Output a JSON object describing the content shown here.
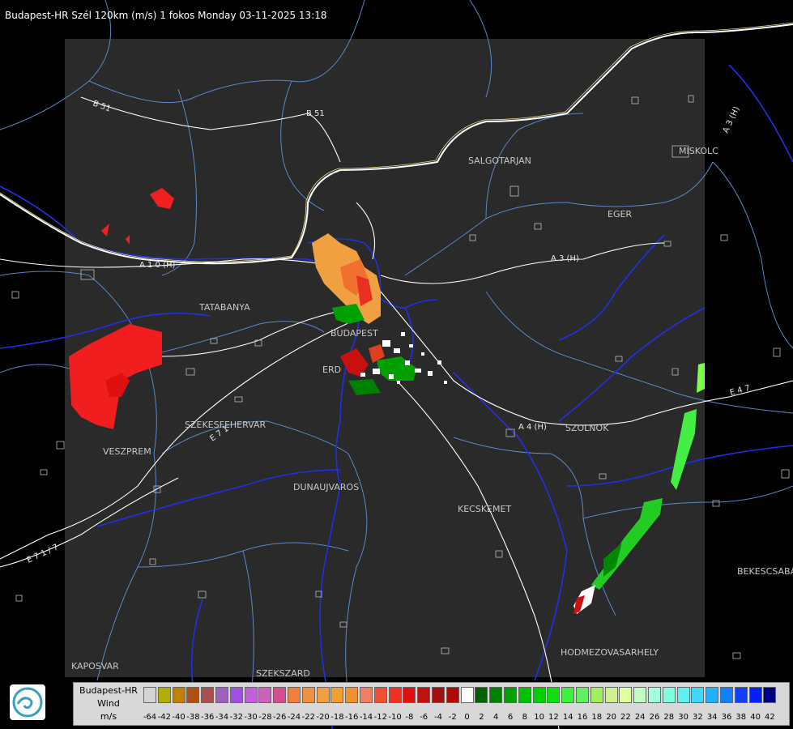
{
  "header": {
    "title": "Budapest-HR Szél 120km (m/s) 1 fokos Monday 03-11-2025 13:18"
  },
  "places": [
    "SALGOTARJAN",
    "MISKOLC",
    "EGER",
    "TATABANYA",
    "BUDAPEST",
    "ERD",
    "SZEKESFEHERVAR",
    "VESZPREM",
    "DUNAUJVAROS",
    "KECSKEMET",
    "SZOLNOK",
    "BEKESCSABA",
    "HODMEZOVASARHELY",
    "KAPOSVAR",
    "SZEKSZARD"
  ],
  "roads": [
    "B 51",
    "B 51",
    "A 3 (H)",
    "A 3 (H)",
    "A 1 0 (H)",
    "A 4 (H)",
    "E 4 7",
    "E 7 1",
    "E 7 1 / 7"
  ],
  "legend": {
    "line1": "Budapest-HR",
    "line2": "Wind",
    "line3": "m/s",
    "labels": [
      "-64",
      "-42",
      "-40",
      "-38",
      "-36",
      "-34",
      "-32",
      "-30",
      "-28",
      "-26",
      "-24",
      "-22",
      "-20",
      "-18",
      "-16",
      "-14",
      "-12",
      "-10",
      "-8",
      "-6",
      "-4",
      "-2",
      "0",
      "2",
      "4",
      "6",
      "8",
      "10",
      "12",
      "14",
      "16",
      "18",
      "20",
      "22",
      "24",
      "26",
      "28",
      "30",
      "32",
      "34",
      "36",
      "38",
      "40",
      "42"
    ],
    "colors": [
      "#d4d4d4",
      "#b0b000",
      "#c08000",
      "#b05010",
      "#a85050",
      "#a060c0",
      "#a050e0",
      "#c060e0",
      "#d060c0",
      "#d05090",
      "#f08040",
      "#f09040",
      "#f0a040",
      "#f0a030",
      "#f09030",
      "#f08060",
      "#f05030",
      "#f03020",
      "#e01010",
      "#c01010",
      "#a01010",
      "#b00808",
      "#ffffff",
      "#006000",
      "#008000",
      "#00a000",
      "#00c000",
      "#00d000",
      "#10e010",
      "#40f040",
      "#60f060",
      "#a0f060",
      "#d0f090",
      "#e0ffa0",
      "#c0ffc0",
      "#a0ffe0",
      "#80ffe0",
      "#60f0f0",
      "#40d8ff",
      "#20b0ff",
      "#1080ff",
      "#1040ff",
      "#0020ff",
      "#000080"
    ]
  },
  "colors": {
    "radar_area": "#2a2a2a",
    "border": "#ffffff",
    "rivers": "#2040ff",
    "counties": "#5a88c8",
    "roads": "#ffffff"
  }
}
